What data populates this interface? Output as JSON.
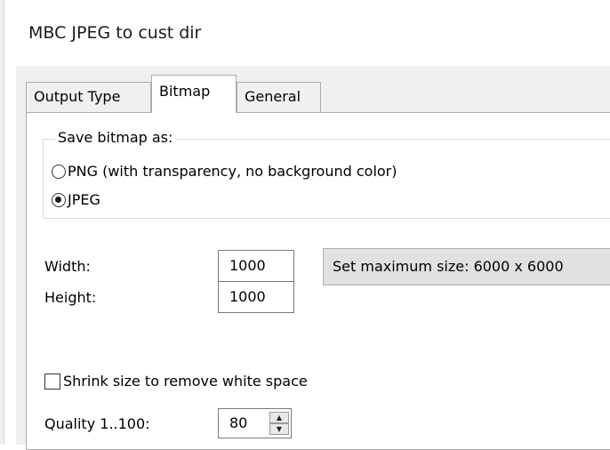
{
  "window": {
    "title": "MBC JPEG to cust dir"
  },
  "tabs": [
    {
      "label": "Output Type",
      "active": false
    },
    {
      "label": "Bitmap",
      "active": true
    },
    {
      "label": "General",
      "active": false
    }
  ],
  "save_group": {
    "legend": "Save bitmap as:",
    "options": [
      {
        "label": "PNG (with transparency, no background color)",
        "selected": false
      },
      {
        "label": "JPEG",
        "selected": true
      }
    ]
  },
  "size": {
    "width_label": "Width:",
    "width_value": "1000",
    "height_label": "Height:",
    "height_value": "1000",
    "max_button_label": "Set maximum size: 6000 x 6000"
  },
  "shrink": {
    "label": "Shrink size to remove white space",
    "checked": false
  },
  "quality": {
    "label": "Quality 1..100:",
    "value": "80"
  },
  "icons": {
    "spin_up": "spin-up-icon",
    "spin_down": "spin-down-icon"
  }
}
